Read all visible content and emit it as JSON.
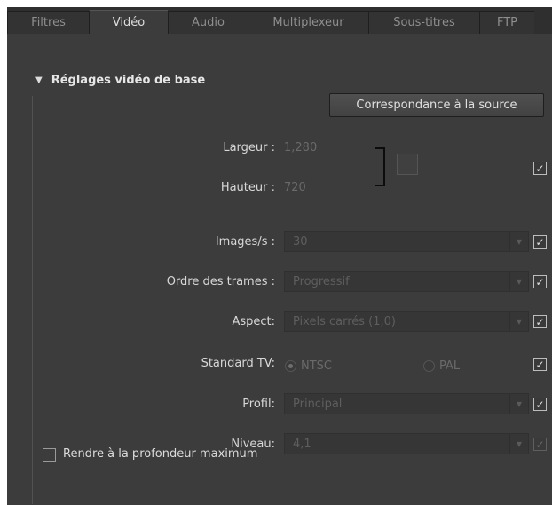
{
  "tabs": [
    {
      "label": "Filtres",
      "active": false
    },
    {
      "label": "Vidéo",
      "active": true
    },
    {
      "label": "Audio",
      "active": false
    },
    {
      "label": "Multiplexeur",
      "active": false
    },
    {
      "label": "Sous-titres",
      "active": false
    },
    {
      "label": "FTP",
      "active": false
    }
  ],
  "section": {
    "title": "Réglages vidéo de base",
    "match_source_label": "Correspondance à la source"
  },
  "fields": {
    "width_label": "Largeur :",
    "width_value": "1,280",
    "height_label": "Hauteur :",
    "height_value": "720",
    "fps_label": "Images/s :",
    "fps_value": "30",
    "field_order_label": "Ordre des trames :",
    "field_order_value": "Progressif",
    "aspect_label": "Aspect:",
    "aspect_value": "Pixels carrés (1,0)",
    "tv_standard_label": "Standard TV:",
    "tv_ntsc": "NTSC",
    "tv_pal": "PAL",
    "profile_label": "Profil:",
    "profile_value": "Principal",
    "level_label": "Niveau:",
    "level_value": "4,1"
  },
  "checkmark": "✓",
  "render_max_label": "Rendre à la profondeur maximum",
  "colors": {
    "panel_bg": "#3c3c3c",
    "tab_bg": "#333333",
    "disabled_text": "#6a6a6a"
  }
}
